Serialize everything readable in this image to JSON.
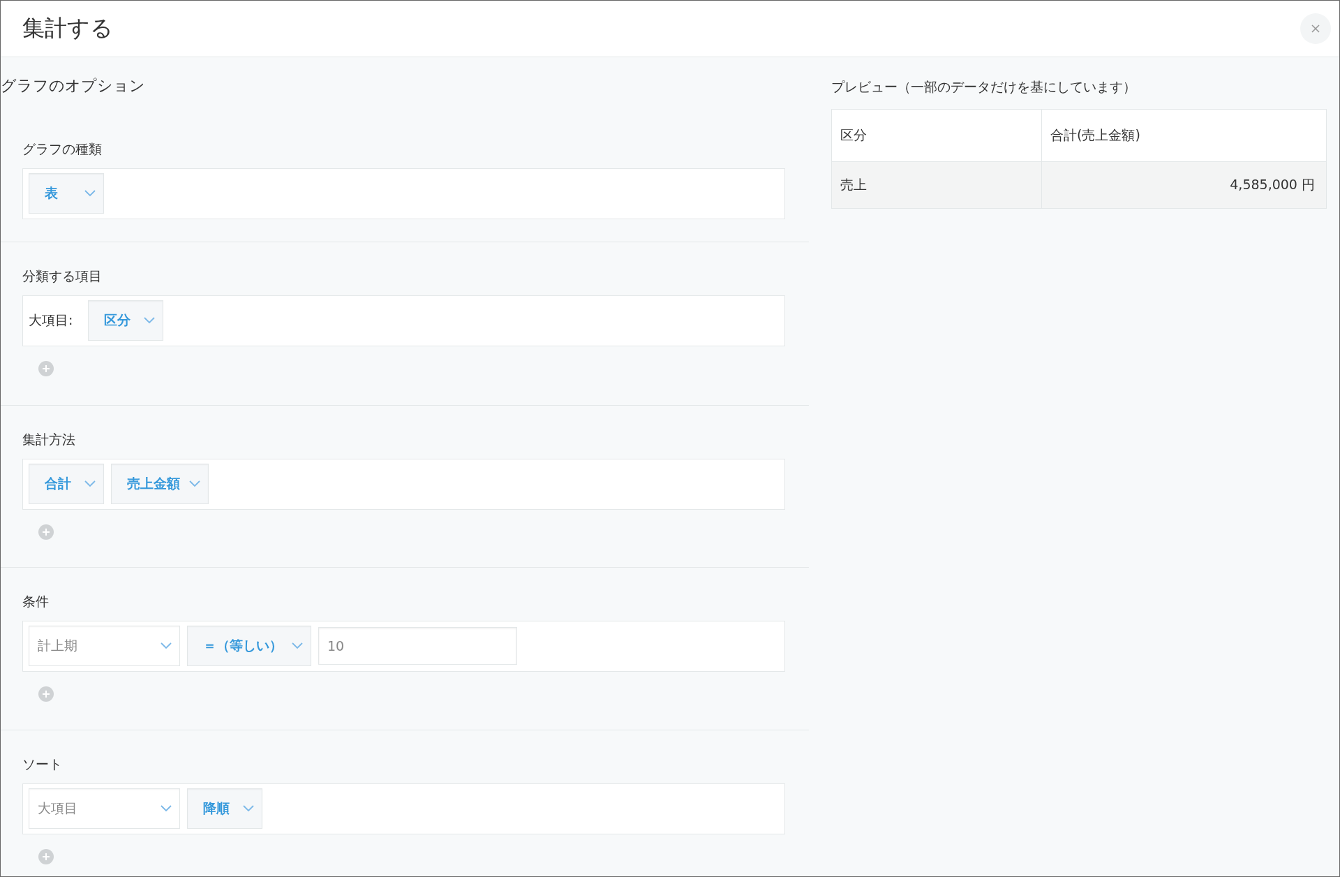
{
  "dialog": {
    "title": "集計する"
  },
  "options": {
    "heading": "グラフのオプション",
    "sections": [
      {
        "label": "グラフの種類",
        "addable": false,
        "controls": [
          {
            "kind": "select",
            "value": "表"
          }
        ]
      },
      {
        "label": "分類する項目",
        "addable": true,
        "controls": [
          {
            "kind": "label",
            "text": "大項目:"
          },
          {
            "kind": "select",
            "value": "区分"
          }
        ]
      },
      {
        "label": "集計方法",
        "addable": true,
        "controls": [
          {
            "kind": "select",
            "value": "合計"
          },
          {
            "kind": "select",
            "value": "売上金額"
          }
        ]
      },
      {
        "label": "条件",
        "addable": true,
        "controls": [
          {
            "kind": "combo",
            "value": "計上期"
          },
          {
            "kind": "select",
            "value": "＝（等しい）"
          },
          {
            "kind": "input",
            "value": "10"
          }
        ]
      },
      {
        "label": "ソート",
        "addable": true,
        "controls": [
          {
            "kind": "combo",
            "value": "大項目"
          },
          {
            "kind": "select",
            "value": "降順"
          }
        ]
      }
    ]
  },
  "preview": {
    "title": "プレビュー（一部のデータだけを基にしています）",
    "columns": [
      "区分",
      "合計(売上金額)"
    ],
    "rows": [
      [
        "売上",
        "4,585,000 円"
      ]
    ]
  }
}
